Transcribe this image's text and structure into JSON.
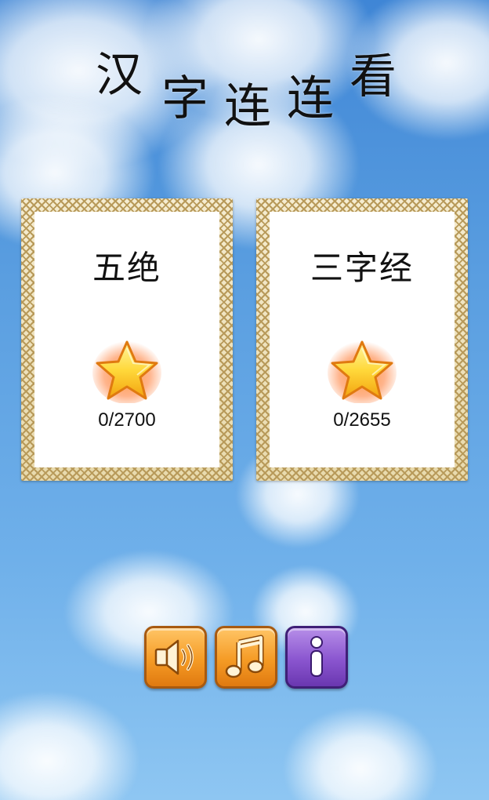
{
  "title": {
    "chars": [
      "汉",
      "字",
      "连",
      "连",
      "看"
    ]
  },
  "modes": [
    {
      "name": "五绝",
      "score": "0/2700"
    },
    {
      "name": "三字经",
      "score": "0/2655"
    }
  ],
  "controls": {
    "sound_icon": "speaker-icon",
    "music_icon": "music-note-icon",
    "info_icon": "info-icon"
  },
  "colors": {
    "sky": "#5a9ee0",
    "button_orange": "#f59b25",
    "button_purple": "#8a55cf",
    "card_frame": "#d8c79a",
    "star": "#ffd23a"
  }
}
